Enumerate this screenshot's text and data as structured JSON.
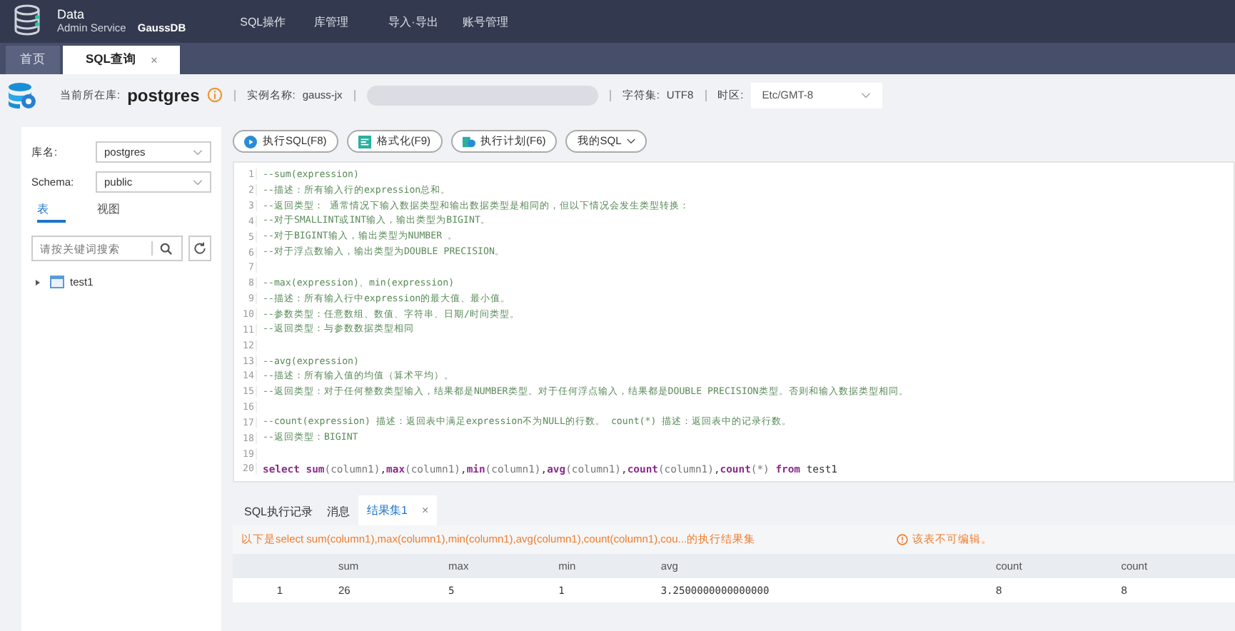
{
  "header": {
    "brand_line1": "Data",
    "brand_line2": "Admin Service",
    "product": "GaussDB",
    "menu": [
      {
        "label": "SQL操作"
      },
      {
        "label": "库管理"
      },
      {
        "label": "导入·导出"
      },
      {
        "label": "账号管理"
      }
    ]
  },
  "tabs": [
    {
      "label": "首页",
      "selected": false
    },
    {
      "label": "SQL查询",
      "selected": true,
      "close": "×"
    }
  ],
  "info_bar": {
    "db_label": "当前所在库:",
    "db_name": "postgres",
    "instance_label": "实例名称:",
    "instance": "gauss-jx",
    "charset_label": "字符集:",
    "charset": "UTF8",
    "timezone_label": "时区:",
    "timezone": "Etc/GMT-8"
  },
  "sidebar": {
    "db_label": "库名:",
    "db_value": "postgres",
    "schema_label": "Schema:",
    "schema_value": "public",
    "tabs": [
      {
        "label": "表",
        "selected": true
      },
      {
        "label": "视图",
        "selected": false
      }
    ],
    "search": {
      "placeholder": "请按关键词搜索"
    },
    "tree": [
      {
        "label": "test1",
        "expanded": false
      }
    ]
  },
  "toolbar": [
    {
      "label": "执行SQL(F8)",
      "kind": "run"
    },
    {
      "label": "格式化(F9)",
      "kind": "format"
    },
    {
      "label": "执行计划(F6)",
      "kind": "plan"
    },
    {
      "label": "我的SQL",
      "kind": "menu"
    }
  ],
  "editor": {
    "lines": [
      {
        "no": "1",
        "kind": "comment",
        "text": "--sum(expression)"
      },
      {
        "no": "2",
        "kind": "comment",
        "text": "--描述：所有输入行的expression总和。"
      },
      {
        "no": "3",
        "kind": "comment",
        "text": "--返回类型： 通常情况下输入数据类型和输出数据类型是相同的，但以下情况会发生类型转换："
      },
      {
        "no": "4",
        "kind": "comment",
        "text": "--对于SMALLINT或INT输入，输出类型为BIGINT。"
      },
      {
        "no": "5",
        "kind": "comment",
        "text": "--对于BIGINT输入，输出类型为NUMBER 。"
      },
      {
        "no": "6",
        "kind": "comment",
        "text": "--对于浮点数输入，输出类型为DOUBLE PRECISION。"
      },
      {
        "no": "7",
        "kind": "comment"
      },
      {
        "no": "8",
        "kind": "comment",
        "text": "--max(expression)、min(expression)"
      },
      {
        "no": "9",
        "kind": "comment",
        "text": "--描述：所有输入行中expression的最大值、最小值。"
      },
      {
        "no": "10",
        "kind": "comment",
        "text": "--参数类型：任意数组、数值、字符串、日期/时间类型。"
      },
      {
        "no": "11",
        "kind": "comment",
        "text": "--返回类型：与参数数据类型相同"
      },
      {
        "no": "12",
        "kind": "comment"
      },
      {
        "no": "13",
        "kind": "comment",
        "text": "--avg(expression)"
      },
      {
        "no": "14",
        "kind": "comment",
        "text": "--描述：所有输入值的均值（算术平均）。"
      },
      {
        "no": "15",
        "kind": "comment",
        "text": "--返回类型：对于任何整数类型输入，结果都是NUMBER类型。对于任何浮点输入，结果都是DOUBLE PRECISION类型。否则和输入数据类型相同。"
      },
      {
        "no": "16",
        "kind": "comment"
      },
      {
        "no": "17",
        "kind": "comment",
        "text": "--count(expression) 描述：返回表中满足expression不为NULL的行数。  count(*) 描述：返回表中的记录行数。"
      },
      {
        "no": "18",
        "kind": "comment",
        "text": "--返回类型：BIGINT"
      },
      {
        "no": "19",
        "kind": "comment"
      },
      {
        "no": "20",
        "kind": "sql",
        "tokens": [
          {
            "kind": "keyword",
            "text": "select"
          },
          {
            "kind": "keyword",
            "text": "sum"
          },
          {
            "kind": "arg",
            "text": "(column1)"
          },
          {
            "kind": "plain",
            "text": ","
          },
          {
            "kind": "keyword",
            "text": "max"
          },
          {
            "kind": "arg",
            "text": "(column1)"
          },
          {
            "kind": "plain",
            "text": ","
          },
          {
            "kind": "keyword",
            "text": "min"
          },
          {
            "kind": "arg",
            "text": "(column1)"
          },
          {
            "kind": "plain",
            "text": ","
          },
          {
            "kind": "keyword",
            "text": "avg"
          },
          {
            "kind": "arg",
            "text": "(column1)"
          },
          {
            "kind": "plain",
            "text": ","
          },
          {
            "kind": "keyword",
            "text": "count"
          },
          {
            "kind": "arg",
            "text": "(column1)"
          },
          {
            "kind": "plain",
            "text": ","
          },
          {
            "kind": "keyword",
            "text": "count"
          },
          {
            "kind": "arg",
            "text": "(*)"
          },
          {
            "kind": "keyword",
            "text": "from"
          },
          {
            "kind": "plain",
            "text": " test1"
          }
        ]
      }
    ]
  },
  "result_tabs": [
    {
      "label": "SQL执行记录",
      "selected": false
    },
    {
      "label": "消息",
      "selected": false
    },
    {
      "label": "结果集1",
      "selected": true,
      "close": "×"
    }
  ],
  "result_notice": "以下是select sum(column1),max(column1),min(column1),avg(column1),count(column1),cou...的执行结果集",
  "readonly_notice": "该表不可编辑。",
  "table": {
    "columns": [
      "",
      "sum",
      "max",
      "min",
      "avg",
      "count",
      "count"
    ],
    "rows": [
      [
        "1",
        "26",
        "5",
        "1",
        "3.2500000000000000",
        "8",
        "8"
      ]
    ]
  }
}
